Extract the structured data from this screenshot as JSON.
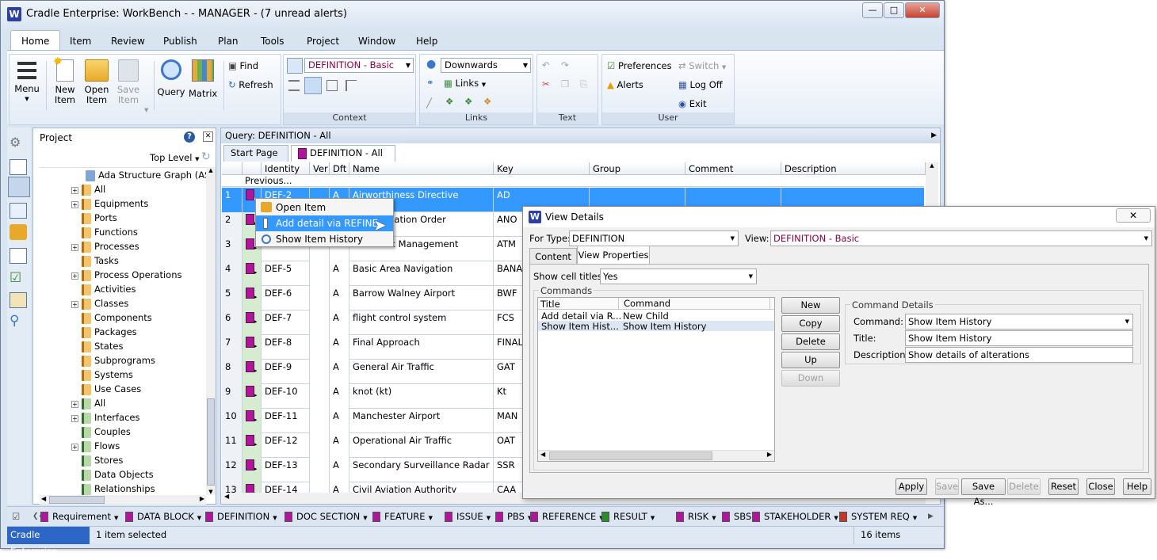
{
  "window": {
    "title": "Cradle Enterprise: WorkBench -  - MANAGER - (7 unread alerts)"
  },
  "ribbon_tabs": [
    "Home",
    "Item",
    "Review",
    "Publish",
    "Plan",
    "Tools",
    "Project",
    "Window",
    "Help"
  ],
  "ribbon": {
    "menu": "Menu",
    "new_item": [
      "New",
      "Item"
    ],
    "open_item": [
      "Open",
      "Item"
    ],
    "save_item": [
      "Save",
      "Item"
    ],
    "query": "Query",
    "matrix": "Matrix",
    "find": "Find",
    "refresh": "Refresh",
    "context_combo": "DEFINITION - Basic",
    "context_label": "Context",
    "direction_combo": "Downwards",
    "links": "Links",
    "links_label": "Links",
    "text_label": "Text",
    "preferences": "Preferences",
    "alerts": "Alerts",
    "switch": "Switch",
    "log_off": "Log Off",
    "exit": "Exit",
    "user_label": "User"
  },
  "project_panel": {
    "title": "Project",
    "level": "Top Level",
    "tree": [
      {
        "label": "Ada Structure Graph (ASC",
        "expander": false,
        "color": "none"
      },
      {
        "label": "All",
        "expander": true,
        "color": "orange"
      },
      {
        "label": "Equipments",
        "expander": true,
        "color": "orange"
      },
      {
        "label": "Ports",
        "expander": false,
        "color": "orange"
      },
      {
        "label": "Functions",
        "expander": false,
        "color": "orange"
      },
      {
        "label": "Processes",
        "expander": true,
        "color": "orange"
      },
      {
        "label": "Tasks",
        "expander": false,
        "color": "orange"
      },
      {
        "label": "Process Operations",
        "expander": true,
        "color": "orange"
      },
      {
        "label": "Activities",
        "expander": false,
        "color": "orange"
      },
      {
        "label": "Classes",
        "expander": true,
        "color": "orange"
      },
      {
        "label": "Components",
        "expander": false,
        "color": "orange"
      },
      {
        "label": "Packages",
        "expander": false,
        "color": "orange"
      },
      {
        "label": "States",
        "expander": false,
        "color": "orange"
      },
      {
        "label": "Subprograms",
        "expander": false,
        "color": "orange"
      },
      {
        "label": "Systems",
        "expander": false,
        "color": "orange"
      },
      {
        "label": "Use Cases",
        "expander": false,
        "color": "orange"
      },
      {
        "label": "All",
        "expander": true,
        "color": "green"
      },
      {
        "label": "Interfaces",
        "expander": true,
        "color": "green"
      },
      {
        "label": "Couples",
        "expander": false,
        "color": "green"
      },
      {
        "label": "Flows",
        "expander": true,
        "color": "green"
      },
      {
        "label": "Stores",
        "expander": false,
        "color": "green"
      },
      {
        "label": "Data Objects",
        "expander": false,
        "color": "green"
      },
      {
        "label": "Relationships",
        "expander": false,
        "color": "green"
      }
    ]
  },
  "query": {
    "header": "Query: DEFINITION - All",
    "tabs": [
      "Start Page",
      "DEFINITION - All"
    ],
    "columns": [
      "Identity",
      "Ver",
      "Dft",
      "Name",
      "Key",
      "Group",
      "Comment",
      "Description"
    ],
    "previous": "Previous...",
    "rows": [
      {
        "n": "1",
        "id": "DEF-2",
        "dft": "A",
        "name": "Airworthiness Directive",
        "key": "AD"
      },
      {
        "n": "2",
        "id": "DEF-3",
        "dft": "A",
        "name": "Air Navigation Order",
        "key": "ANO"
      },
      {
        "n": "3",
        "id": "DEF-4",
        "dft": "A",
        "name": "Air Traffic Management",
        "key": "ATM"
      },
      {
        "n": "4",
        "id": "DEF-5",
        "dft": "A",
        "name": "Basic Area Navigation",
        "key": "BANAV"
      },
      {
        "n": "5",
        "id": "DEF-6",
        "dft": "A",
        "name": "Barrow Walney Airport",
        "key": "BWF"
      },
      {
        "n": "6",
        "id": "DEF-7",
        "dft": "A",
        "name": "flight control system",
        "key": "FCS"
      },
      {
        "n": "7",
        "id": "DEF-8",
        "dft": "A",
        "name": "Final Approach",
        "key": "FINAL"
      },
      {
        "n": "8",
        "id": "DEF-9",
        "dft": "A",
        "name": "General Air Traffic",
        "key": "GAT"
      },
      {
        "n": "9",
        "id": "DEF-10",
        "dft": "A",
        "name": "knot (kt)",
        "key": "Kt"
      },
      {
        "n": "10",
        "id": "DEF-11",
        "dft": "A",
        "name": "Manchester Airport",
        "key": "MAN"
      },
      {
        "n": "11",
        "id": "DEF-12",
        "dft": "A",
        "name": "Operational Air Traffic",
        "key": "OAT"
      },
      {
        "n": "12",
        "id": "DEF-13",
        "dft": "A",
        "name": "Secondary Surveillance Radar",
        "key": "SSR"
      },
      {
        "n": "13",
        "id": "DEF-14",
        "dft": "A",
        "name": "Civil Aviation Authority",
        "key": "CAA"
      }
    ]
  },
  "context_menu": [
    "Open Item",
    "Add detail via REFINE",
    "Show Item History"
  ],
  "view_details": {
    "title": "View Details",
    "for_type_label": "For Type:",
    "for_type": "DEFINITION",
    "view_label": "View:",
    "view": "DEFINITION - Basic",
    "tabs": [
      "Content",
      "View Properties"
    ],
    "show_cell_titles_label": "Show cell titles:",
    "show_cell_titles": "Yes",
    "commands_group": "Commands",
    "cmd_columns": [
      "Title",
      "Command"
    ],
    "cmd_rows": [
      {
        "title": "Add detail via R...",
        "command": "New Child"
      },
      {
        "title": "Show Item Hist...",
        "command": "Show Item History"
      }
    ],
    "side_buttons": [
      "New",
      "Copy",
      "Delete",
      "Up",
      "Down"
    ],
    "details_group": "Command Details",
    "command_label": "Command:",
    "command": "Show Item History",
    "title_label": "Title:",
    "title_value": "Show Item History",
    "description_label": "Description:",
    "description": "Show details of alterations",
    "bottom_buttons": [
      "Apply",
      "Save",
      "Save As...",
      "Delete",
      "Reset",
      "Close",
      "Help"
    ]
  },
  "bottom_types": [
    {
      "label": "Requirement",
      "color": "#b0169b"
    },
    {
      "label": "DATA BLOCK",
      "color": "#b0169b"
    },
    {
      "label": "DEFINITION",
      "color": "#b0169b"
    },
    {
      "label": "DOC SECTION",
      "color": "#b0169b"
    },
    {
      "label": "FEATURE",
      "color": "#b0169b"
    },
    {
      "label": "ISSUE",
      "color": "#b0169b"
    },
    {
      "label": "PBS",
      "color": "#b0169b"
    },
    {
      "label": "REFERENCE",
      "color": "#b0169b"
    },
    {
      "label": "RESULT",
      "color": "#2e8b2e"
    },
    {
      "label": "RISK",
      "color": "#b0169b"
    },
    {
      "label": "SBS",
      "color": "#b0169b"
    },
    {
      "label": "STAKEHOLDER",
      "color": "#b0169b"
    },
    {
      "label": "SYSTEM REQ",
      "color": "#c0392b"
    }
  ],
  "status": {
    "app": "Cradle Enterprise",
    "selection": "1 item selected",
    "count": "16 items"
  }
}
